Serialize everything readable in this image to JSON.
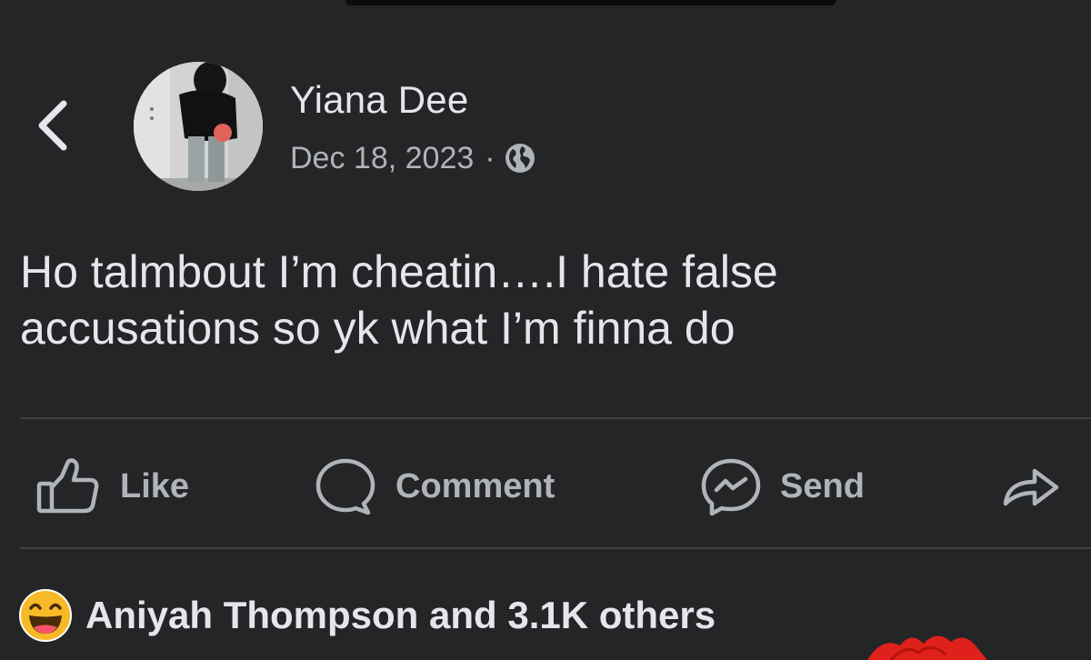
{
  "post": {
    "author": "Yiana Dee",
    "date": "Dec 18, 2023",
    "separator": "·",
    "audience_icon": "globe-icon",
    "text": "Ho talmbout I’m cheatin….I hate false\naccusations so yk what I’m finna do"
  },
  "header": {
    "back_icon": "chevron-left-icon"
  },
  "actions": {
    "like_label": "Like",
    "comment_label": "Comment",
    "send_label": "Send"
  },
  "reactions": {
    "emoji": "laughing-face-icon",
    "summary": "Aniyah Thompson and 3.1K others"
  },
  "colors": {
    "background": "#242526",
    "primary_text": "#e4e6eb",
    "secondary_text": "#b0b3b8",
    "divider": "#3e4042",
    "reaction_yellow": "#f7b928",
    "scribble_red": "#e0201a"
  }
}
